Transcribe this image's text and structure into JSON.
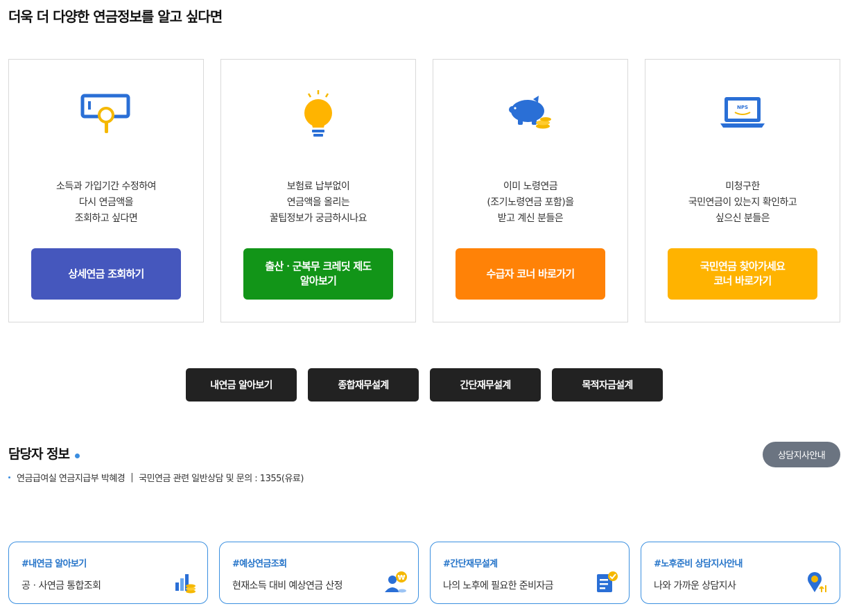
{
  "section_title": "더욱 더 다양한 연금정보를 알고 싶다면",
  "cards": [
    {
      "icon": "magnifier-screen-icon",
      "desc": [
        "소득과 가입기간 수정하여",
        "다시 연금액을",
        "조회하고 싶다면"
      ],
      "button": [
        "상세연금 조회하기"
      ],
      "color": "#4557bd"
    },
    {
      "icon": "lightbulb-icon",
      "desc": [
        "보험료 납부없이",
        "연금액을 올리는",
        "꿀팁정보가 궁금하시나요"
      ],
      "button": [
        "출산ㆍ군복무 크레딧 제도",
        "알아보기"
      ],
      "color": "#129518"
    },
    {
      "icon": "piggy-bank-icon",
      "desc": [
        "이미 노령연금",
        "(조기노령연금 포함)을",
        "받고 계신 분들은"
      ],
      "button": [
        "수급자 코너 바로가기"
      ],
      "color": "#ff8207"
    },
    {
      "icon": "nps-laptop-icon",
      "desc": [
        "미청구한",
        "국민연금이 있는지 확인하고",
        "싶으신 분들은"
      ],
      "button": [
        "국민연금 찾아가세요",
        "코너 바로가기"
      ],
      "color": "#ffb300"
    }
  ],
  "laptop_label": "NPS",
  "quick_buttons": [
    "내연금 알아보기",
    "종합재무설계",
    "간단재무설계",
    "목적자금설계"
  ],
  "contact": {
    "title": "담당자 정보",
    "branch_button": "상담지사안내",
    "dept": "연금급여실 연금지급부 박혜경",
    "separator": "|",
    "inquiry": "국민연금 관련 일반상담 및 문의 : 1355(유료)"
  },
  "links": [
    {
      "tag": "#내연금 알아보기",
      "sub": "공ㆍ사연금 통합조회",
      "icon": "bar-chart-coins-icon"
    },
    {
      "tag": "#예상연금조회",
      "sub": "현재소득 대비 예상연금 산정",
      "icon": "person-coin-icon"
    },
    {
      "tag": "#간단재무설계",
      "sub": "나의 노후에 필요한 준비자금",
      "icon": "document-check-icon"
    },
    {
      "tag": "#노후준비 상담지사안내",
      "sub": "나와 가까운 상담지사",
      "icon": "location-pin-icon"
    }
  ],
  "colors": {
    "accent_blue": "#3a8fe0",
    "dark_button": "#222222",
    "grey_button": "#6b7481"
  },
  "coin_symbol": "₩"
}
